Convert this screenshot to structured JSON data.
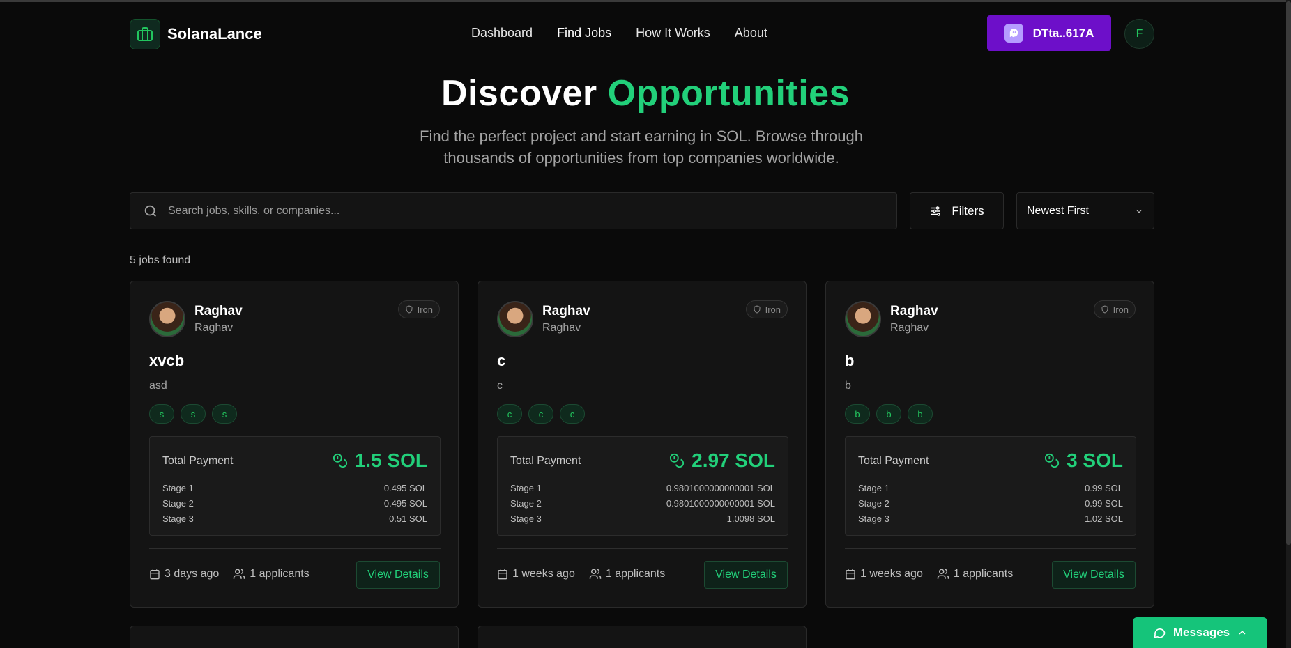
{
  "header": {
    "brand": "SolanaLance",
    "nav": [
      "Dashboard",
      "Find Jobs",
      "How It Works",
      "About"
    ],
    "active_nav": "Find Jobs",
    "wallet_label": "DTta..617A",
    "user_initial": "F"
  },
  "hero": {
    "title_plain": "Discover",
    "title_accent": "Opportunities",
    "subtitle": "Find the perfect project and start earning in SOL. Browse through thousands of opportunities from top companies worldwide."
  },
  "controls": {
    "search_placeholder": "Search jobs, skills, or companies...",
    "filters_label": "Filters",
    "sort_value": "Newest First"
  },
  "results": {
    "count_text": "5 jobs found"
  },
  "jobs": [
    {
      "poster_name": "Raghav",
      "poster_handle": "Raghav",
      "tier": "Iron",
      "title": "xvcb",
      "description": "asd",
      "tags": [
        "s",
        "s",
        "s"
      ],
      "payment_label": "Total Payment",
      "total": "1.5 SOL",
      "stages": [
        {
          "label": "Stage 1",
          "amount": "0.495 SOL"
        },
        {
          "label": "Stage 2",
          "amount": "0.495 SOL"
        },
        {
          "label": "Stage 3",
          "amount": "0.51 SOL"
        }
      ],
      "posted": "3 days ago",
      "applicants": "1 applicants",
      "cta": "View Details"
    },
    {
      "poster_name": "Raghav",
      "poster_handle": "Raghav",
      "tier": "Iron",
      "title": "c",
      "description": "c",
      "tags": [
        "c",
        "c",
        "c"
      ],
      "payment_label": "Total Payment",
      "total": "2.97 SOL",
      "stages": [
        {
          "label": "Stage 1",
          "amount": "0.9801000000000001 SOL"
        },
        {
          "label": "Stage 2",
          "amount": "0.9801000000000001 SOL"
        },
        {
          "label": "Stage 3",
          "amount": "1.0098 SOL"
        }
      ],
      "posted": "1 weeks ago",
      "applicants": "1 applicants",
      "cta": "View Details"
    },
    {
      "poster_name": "Raghav",
      "poster_handle": "Raghav",
      "tier": "Iron",
      "title": "b",
      "description": "b",
      "tags": [
        "b",
        "b",
        "b"
      ],
      "payment_label": "Total Payment",
      "total": "3 SOL",
      "stages": [
        {
          "label": "Stage 1",
          "amount": "0.99 SOL"
        },
        {
          "label": "Stage 2",
          "amount": "0.99 SOL"
        },
        {
          "label": "Stage 3",
          "amount": "1.02 SOL"
        }
      ],
      "posted": "1 weeks ago",
      "applicants": "1 applicants",
      "cta": "View Details"
    }
  ],
  "messages_label": "Messages",
  "colors": {
    "accent": "#22d07a",
    "wallet": "#6d0fc9",
    "background": "#0a0a0a"
  },
  "icons": [
    "briefcase-icon",
    "ghost-icon",
    "search-icon",
    "sliders-icon",
    "chevron-down-icon",
    "shield-icon",
    "coins-icon",
    "calendar-icon",
    "users-icon",
    "message-circle-icon",
    "chevron-up-icon"
  ]
}
